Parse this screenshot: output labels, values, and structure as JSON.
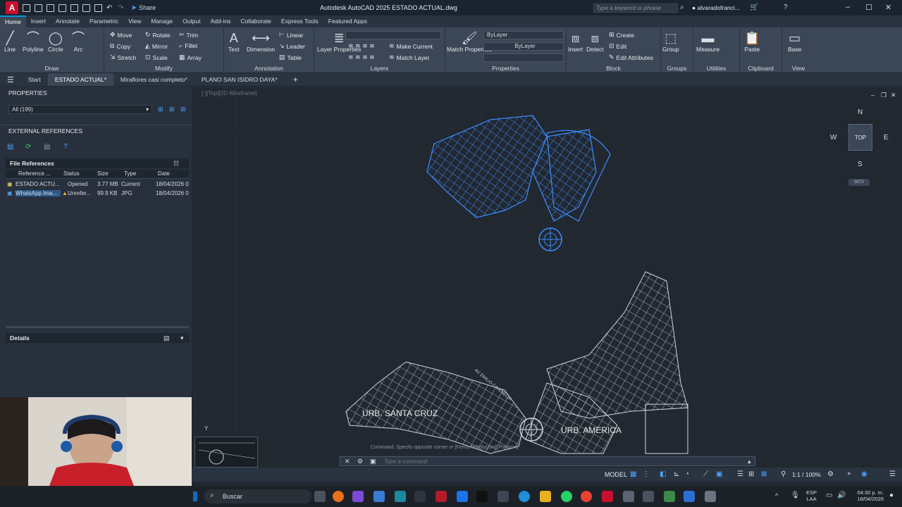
{
  "title_bar": {
    "app_title": "Autodesk AutoCAD 2025    ESTADO ACTUAL.dwg",
    "share_label": "Share",
    "search_placeholder": "Type a keyword or phrase",
    "user_name": "alvaradofranci..."
  },
  "menu_tabs": [
    "Home",
    "Insert",
    "Annotate",
    "Parametric",
    "View",
    "Manage",
    "Output",
    "Add-ins",
    "Collaborate",
    "Express Tools",
    "Featured Apps"
  ],
  "ribbon": {
    "draw": {
      "title": "Draw",
      "line": "Line",
      "polyline": "Polyline",
      "circle": "Circle",
      "arc": "Arc"
    },
    "modify": {
      "title": "Modify",
      "move": "Move",
      "rotate": "Rotate",
      "trim": "Trim",
      "copy": "Copy",
      "mirror": "Mirror",
      "fillet": "Fillet",
      "stretch": "Stretch",
      "scale": "Scale",
      "array": "Array"
    },
    "annotation": {
      "title": "Annotation",
      "text": "Text",
      "dimension": "Dimension",
      "linear": "Linear",
      "leader": "Leader",
      "table": "Table"
    },
    "layers": {
      "title": "Layers",
      "layer_properties": "Layer Properties",
      "make_current": "Make Current",
      "match_layer": "Match Layer"
    },
    "properties": {
      "title": "Properties",
      "match_properties": "Match Properties",
      "bylayer1": "ByLayer",
      "bylayer2": "ByLayer"
    },
    "block": {
      "title": "Block",
      "insert": "Insert",
      "detect": "Detect",
      "create": "Create",
      "edit": "Edit",
      "edit_attributes": "Edit Attributes"
    },
    "groups": {
      "title": "Groups",
      "group": "Group"
    },
    "utilities": {
      "title": "Utilities",
      "measure": "Measure"
    },
    "clipboard": {
      "title": "Clipboard",
      "paste": "Paste"
    },
    "view": {
      "title": "View",
      "base": "Base"
    }
  },
  "doc_tabs": [
    "Start",
    "ESTADO ACTUAL*",
    "Miraflores casi completo*",
    "PLANO SAN ISIDRO DAYA*"
  ],
  "left_panel": {
    "properties_header": "PROPERTIES",
    "selection": "All (199)",
    "xref_header": "EXTERNAL REFERENCES",
    "file_refs_title": "File References",
    "columns": [
      "Reference ...",
      "Status",
      "Size",
      "Type",
      "Date"
    ],
    "rows": [
      {
        "name": "ESTADO ACTU...",
        "status": "Opened",
        "size": "3.77 MB",
        "type": "Current",
        "date": "18/04/2026 0:"
      },
      {
        "name": "WhatsApp Ima...",
        "status": "Unrefer...",
        "size": "99.9 KB",
        "type": "JPG",
        "date": "18/04/2026 0:"
      }
    ],
    "details_title": "Details"
  },
  "canvas": {
    "viewport_label": "[-][Top][2D Wireframe]",
    "viewcube": {
      "top": "TOP",
      "n": "N",
      "s": "S",
      "e": "E",
      "w": "W",
      "wcs": "WCS"
    },
    "label_santa_cruz": "URB. SANTA CRUZ",
    "label_america": "URB. AMERICA",
    "street_label": "AV. EMILIO CAVENECIA",
    "command_hint": "Command: Specify opposite corner or [Fence/WPolygon/CPolygon]:",
    "command_placeholder": "Type a command"
  },
  "status_bar": {
    "model": "MODEL",
    "scale": "1:1 / 100%"
  },
  "taskbar": {
    "search_label": "Buscar",
    "lang1": "ESP",
    "lang2": "LAA",
    "time": "04:30 p. m.",
    "date": "18/04/2026"
  },
  "colors": {
    "accent": "#0696d7",
    "blue_drawing": "#3d8bff",
    "bg": "#212830"
  }
}
